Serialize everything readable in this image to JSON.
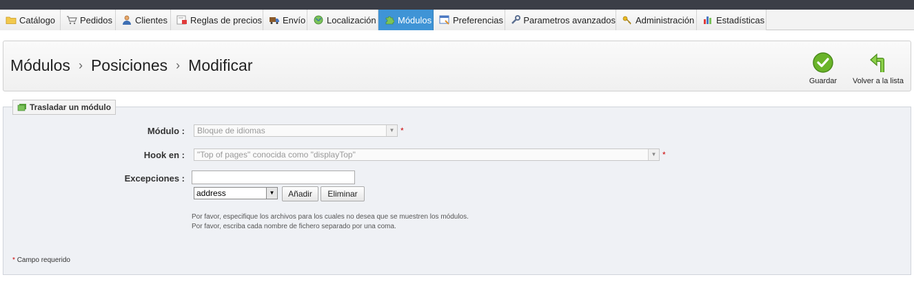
{
  "tabs": [
    {
      "label": "Catálogo",
      "icon": "folder-icon"
    },
    {
      "label": "Pedidos",
      "icon": "cart-icon"
    },
    {
      "label": "Clientes",
      "icon": "user-icon"
    },
    {
      "label": "Reglas de precios",
      "icon": "price-rules-icon"
    },
    {
      "label": "Envío",
      "icon": "truck-icon"
    },
    {
      "label": "Localización",
      "icon": "globe-icon"
    },
    {
      "label": "Módulos",
      "icon": "puzzle-icon"
    },
    {
      "label": "Preferencias",
      "icon": "preferences-icon"
    },
    {
      "label": "Parametros avanzados",
      "icon": "wrench-icon"
    },
    {
      "label": "Administración",
      "icon": "key-icon"
    },
    {
      "label": "Estadísticas",
      "icon": "bar-chart-icon"
    }
  ],
  "breadcrumb": {
    "level1": "Módulos",
    "level2": "Posiciones",
    "level3": "Modificar",
    "sep": "›"
  },
  "toolbar": {
    "save_label": "Guardar",
    "back_label": "Volver a la lista"
  },
  "form": {
    "legend": "Trasladar un módulo",
    "module_label": "Módulo :",
    "module_value": "Bloque de idiomas",
    "hook_label": "Hook en :",
    "hook_value": "\"Top of pages\" conocida como \"displayTop\"",
    "exceptions_label": "Excepciones :",
    "exceptions_value": "",
    "exceptions_select": "address",
    "add_label": "Añadir",
    "remove_label": "Eliminar",
    "required_mark": "*",
    "help_line1": "Por favor, especifique los archivos para los cuales no desea que se muestren los módulos.",
    "help_line2": "Por favor, escriba cada nombre de fichero separado por una coma.",
    "required_note": "Campo requerido"
  },
  "colors": {
    "active_tab": "#3f94d6",
    "topbar": "#3b3e47",
    "save_green": "#6ab42a",
    "required_red": "#cc0000"
  }
}
